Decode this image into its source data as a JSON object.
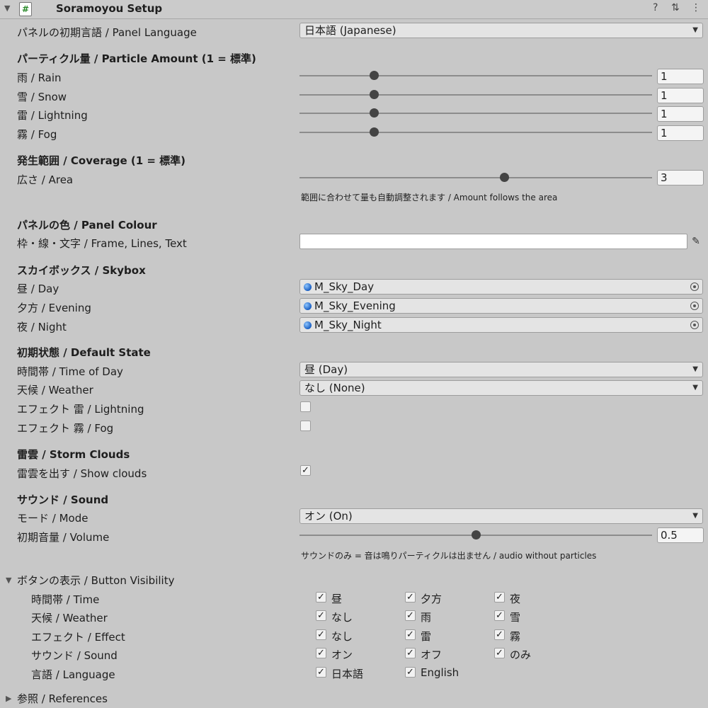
{
  "header": {
    "title": "Soramoyou Setup",
    "script_glyph": "#",
    "fold_glyph": "▼",
    "icons": [
      "help-icon",
      "preset-icon",
      "kebab-menu-icon"
    ],
    "help_glyph": "?",
    "preset_glyph": "⇅",
    "menu_glyph": "⋮"
  },
  "panel_language": {
    "label": "パネルの初期言語 / Panel Language",
    "value": "日本語 (Japanese)"
  },
  "particle": {
    "heading": "パーティクル量 / Particle Amount  (1 = 標準)",
    "rows": [
      {
        "label": "雨 / Rain",
        "value": "1",
        "slider_fraction": 0.21
      },
      {
        "label": "雪 / Snow",
        "value": "1",
        "slider_fraction": 0.21
      },
      {
        "label": "雷 / Lightning",
        "value": "1",
        "slider_fraction": 0.21
      },
      {
        "label": "霧 / Fog",
        "value": "1",
        "slider_fraction": 0.21
      }
    ]
  },
  "coverage": {
    "heading": "発生範囲 / Coverage  (1 = 標準)",
    "area_label": "広さ / Area",
    "area_value": "3",
    "area_slider_fraction": 0.58,
    "hint": "範囲に合わせて量も自動調整されます / Amount follows the area"
  },
  "panel_colour": {
    "heading": "パネルの色 / Panel Colour",
    "label": "枠・線・文字 / Frame, Lines, Text",
    "color": "#ffffff"
  },
  "skybox": {
    "heading": "スカイボックス / Skybox",
    "rows": [
      {
        "label": "昼 / Day",
        "value": "M_Sky_Day"
      },
      {
        "label": "夕方 / Evening",
        "value": "M_Sky_Evening"
      },
      {
        "label": "夜 / Night",
        "value": "M_Sky_Night"
      }
    ]
  },
  "default_state": {
    "heading": "初期状態 / Default State",
    "time_label": "時間帯 / Time of Day",
    "time_value": "昼 (Day)",
    "weather_label": "天候 / Weather",
    "weather_value": "なし (None)",
    "lightning_label": "エフェクト 雷 / Lightning",
    "lightning_checked": false,
    "fog_label": "エフェクト 霧 / Fog",
    "fog_checked": false
  },
  "storm": {
    "heading": "雷雲 / Storm Clouds",
    "label": "雷雲を出す / Show clouds",
    "checked": true
  },
  "sound": {
    "heading": "サウンド / Sound",
    "mode_label": "モード / Mode",
    "mode_value": "オン (On)",
    "volume_label": "初期音量 / Volume",
    "volume_value": "0.5",
    "volume_slider_fraction": 0.5,
    "hint": "サウンドのみ = 音は鳴りパーティクルは出ません / audio without particles"
  },
  "button_visibility": {
    "heading": "ボタンの表示 / Button Visibility",
    "rows": [
      {
        "label": "時間帯 / Time",
        "options": [
          "昼",
          "夕方",
          "夜"
        ]
      },
      {
        "label": "天候 / Weather",
        "options": [
          "なし",
          "雨",
          "雪"
        ]
      },
      {
        "label": "エフェクト / Effect",
        "options": [
          "なし",
          "雷",
          "霧"
        ]
      },
      {
        "label": "サウンド / Sound",
        "options": [
          "オン",
          "オフ",
          "のみ"
        ]
      },
      {
        "label": "言語 / Language",
        "options": [
          "日本語",
          "English"
        ]
      }
    ],
    "check_glyph": "✓"
  },
  "references": {
    "heading": "参照 / References"
  },
  "glyphs": {
    "dropdown_arrow": "▼",
    "fold_open": "▼",
    "fold_closed": "▶",
    "eyedropper": "✎",
    "check": "✓"
  }
}
